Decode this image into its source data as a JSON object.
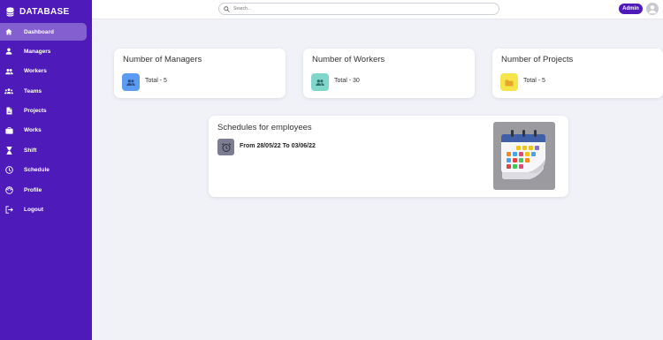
{
  "sidebar": {
    "brand": "DATABASE",
    "items": [
      {
        "label": "Dashboard",
        "icon": "home-icon",
        "active": true
      },
      {
        "label": "Managers",
        "icon": "person-icon"
      },
      {
        "label": "Workers",
        "icon": "people-icon"
      },
      {
        "label": "Teams",
        "icon": "groups-icon"
      },
      {
        "label": "Projects",
        "icon": "document-icon"
      },
      {
        "label": "Works",
        "icon": "briefcase-icon"
      },
      {
        "label": "Shift",
        "icon": "hourglass-icon"
      },
      {
        "label": "Schedule",
        "icon": "clock-icon"
      },
      {
        "label": "Profile",
        "icon": "face-icon"
      },
      {
        "label": "Logout",
        "icon": "logout-icon"
      }
    ]
  },
  "topbar": {
    "search_placeholder": "Search...",
    "user_badge": "Admin"
  },
  "stats": [
    {
      "title": "Number of Managers",
      "count_text": "Total - 5",
      "icon": "people-icon",
      "icon_bg": "#5b9cf2"
    },
    {
      "title": "Number of Workers",
      "count_text": "Total - 30",
      "icon": "people-icon",
      "icon_bg": "#7fd6cb"
    },
    {
      "title": "Number of Projects",
      "count_text": "Total - 5",
      "icon": "folder-icon",
      "icon_bg": "#f6e44b"
    }
  ],
  "schedule": {
    "title": "Schedules for employees",
    "range": "From 28/05/22 To 03/06/22",
    "icon": "alarm-clock-icon",
    "image": "calendar-illustration"
  },
  "colors": {
    "sidebar_bg": "#4e1aba",
    "page_bg": "#f1f1f8"
  }
}
